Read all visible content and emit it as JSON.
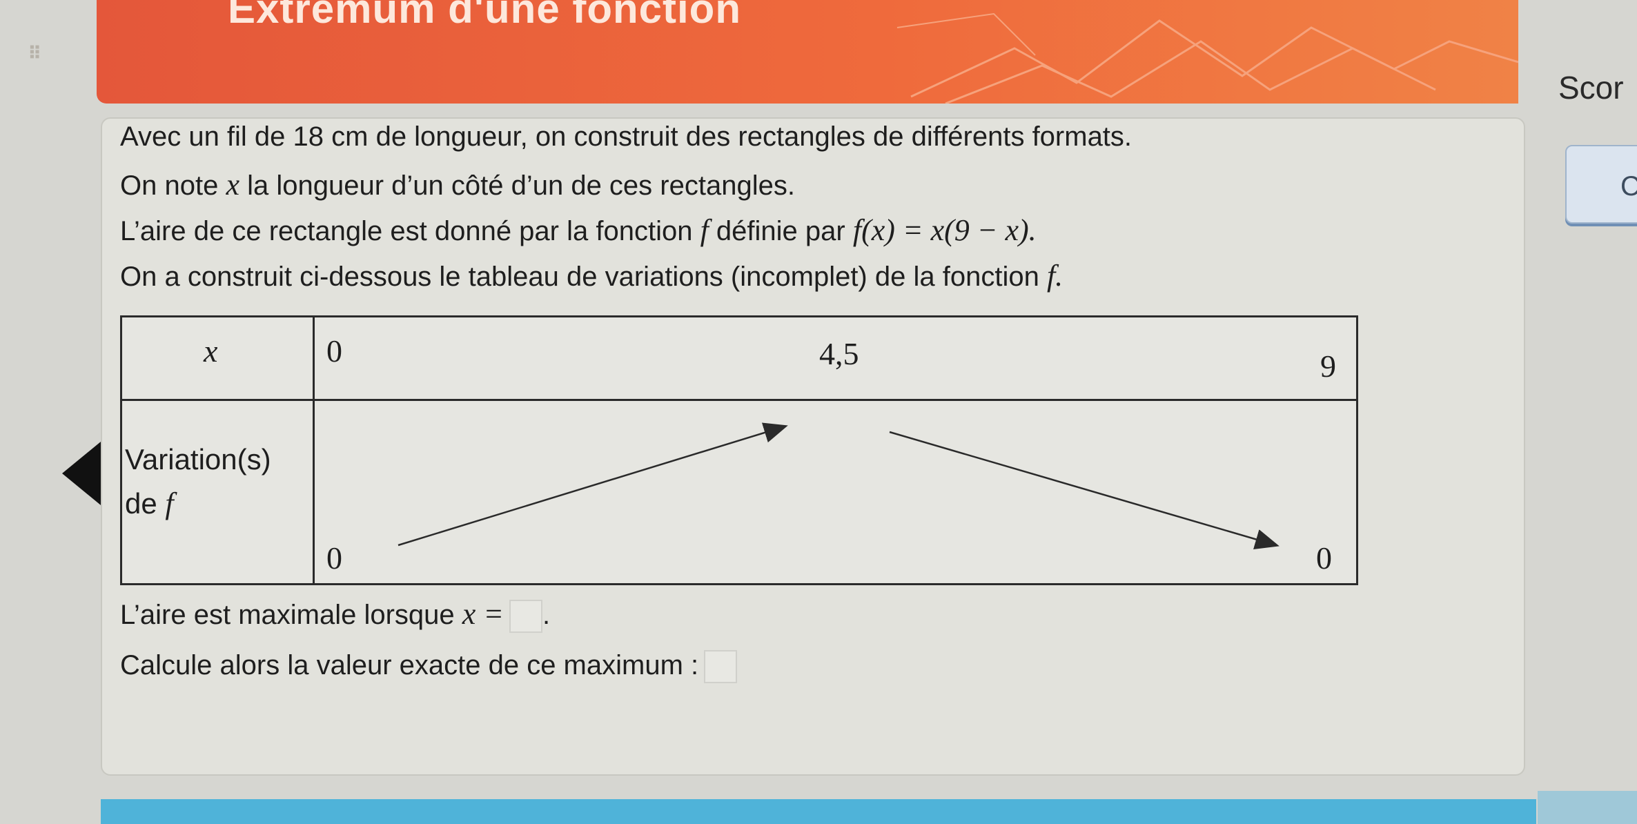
{
  "header": {
    "title": "Extremum d'une fonction",
    "score_label": "Scor"
  },
  "side_button": {
    "label": "Ca"
  },
  "exercise": {
    "line1": "Avec un fil de 18 cm de longueur, on construit des rectangles de différents formats.",
    "line2_pre": "On note ",
    "line2_var": "x",
    "line2_post": " la longueur d’un côté d’un de ces rectangles.",
    "line3_pre": "L’aire de ce rectangle est donné par la fonction ",
    "line3_f": "f",
    "line3_mid": " définie par ",
    "line3_formula": "f(x) = x(9 − x).",
    "line4": "On a construit ci-dessous le tableau de variations (incomplet) de la fonction ",
    "line4_f": "f.",
    "table": {
      "x_header": "x",
      "x_values": [
        "0",
        "4,5",
        "9"
      ],
      "row_label_1": "Variation(s)",
      "row_label_2": "de ",
      "row_label_f": "f",
      "f_values": [
        "0",
        "0"
      ]
    },
    "question1_pre": "L’aire est maximale lorsque ",
    "question1_math": "x =",
    "question1_post": ".",
    "question2": "Calcule alors la valeur exacte de ce maximum :"
  },
  "colors": {
    "banner": "#ef6a3c",
    "accent_blue": "#4fb3d9"
  }
}
